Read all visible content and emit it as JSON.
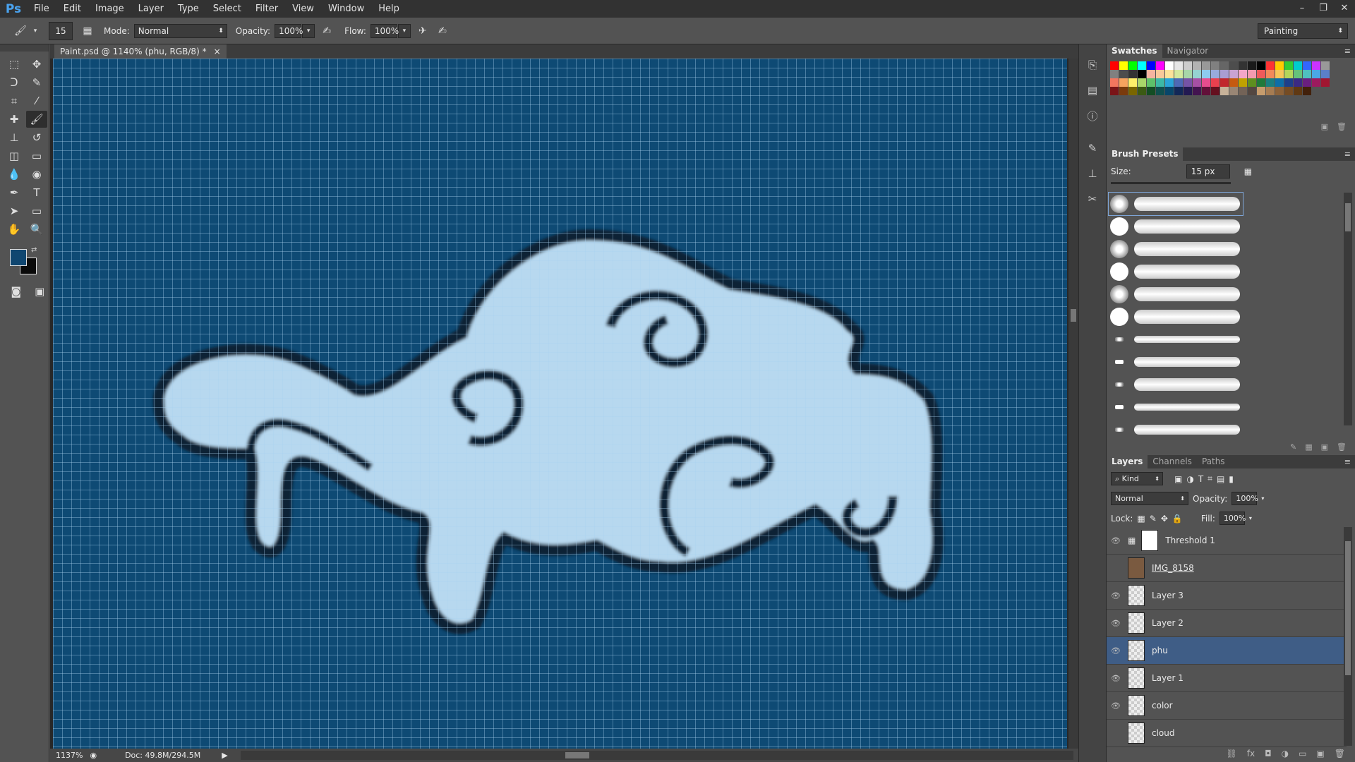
{
  "app": {
    "logo": "Ps"
  },
  "menu": [
    "File",
    "Edit",
    "Image",
    "Layer",
    "Type",
    "Select",
    "Filter",
    "View",
    "Window",
    "Help"
  ],
  "window_controls": [
    "–",
    "❐",
    "✕"
  ],
  "options": {
    "brush_size": "15",
    "mode_label": "Mode:",
    "mode_value": "Normal",
    "opacity_label": "Opacity:",
    "opacity_value": "100%",
    "flow_label": "Flow:",
    "flow_value": "100%",
    "workspace": "Painting"
  },
  "tools": [
    {
      "name": "marquee-icon",
      "glyph": "⬚"
    },
    {
      "name": "move-icon",
      "glyph": "✥"
    },
    {
      "name": "lasso-icon",
      "glyph": "ᑐ"
    },
    {
      "name": "quick-select-icon",
      "glyph": "✎"
    },
    {
      "name": "crop-icon",
      "glyph": "⌗"
    },
    {
      "name": "eyedropper-icon",
      "glyph": "⁄"
    },
    {
      "name": "healing-icon",
      "glyph": "✚"
    },
    {
      "name": "brush-icon",
      "glyph": "🖌"
    },
    {
      "name": "stamp-icon",
      "glyph": "⊥"
    },
    {
      "name": "history-brush-icon",
      "glyph": "↺"
    },
    {
      "name": "eraser-icon",
      "glyph": "◫"
    },
    {
      "name": "gradient-icon",
      "glyph": "▭"
    },
    {
      "name": "blur-icon",
      "glyph": "💧"
    },
    {
      "name": "dodge-icon",
      "glyph": "◉"
    },
    {
      "name": "pen-icon",
      "glyph": "✒"
    },
    {
      "name": "type-icon",
      "glyph": "T"
    },
    {
      "name": "path-select-icon",
      "glyph": "➤"
    },
    {
      "name": "shape-icon",
      "glyph": "▭"
    },
    {
      "name": "hand-icon",
      "glyph": "✋"
    },
    {
      "name": "zoom-icon",
      "glyph": "🔍"
    }
  ],
  "colors": {
    "foreground": "#0f4670",
    "background": "#0a0a0a"
  },
  "document": {
    "tab_title": "Paint.psd @ 1140% (phu, RGB/8) *",
    "close": "×"
  },
  "status": {
    "zoom": "1137%",
    "doc": "Doc: 49.8M/294.5M"
  },
  "swatches_panel": {
    "tabs": [
      "Swatches",
      "Navigator"
    ]
  },
  "swatch_colors": [
    "#ff0000",
    "#ffff00",
    "#00ff00",
    "#00ffff",
    "#0000ff",
    "#ff00ff",
    "#ffffff",
    "#e6e6e6",
    "#cccccc",
    "#b3b3b3",
    "#999999",
    "#808080",
    "#666666",
    "#4d4d4d",
    "#333333",
    "#1a1a1a",
    "#000000",
    "#ff3333",
    "#ffcc00",
    "#33cc33",
    "#00cccc",
    "#3366ff",
    "#cc33ff",
    "#999999",
    "#808080",
    "#4d4d4d",
    "#333333",
    "#000000",
    "#f5b4a0",
    "#f9c89a",
    "#fde39a",
    "#d4e99e",
    "#a7d6a8",
    "#95d3d1",
    "#8ecbf0",
    "#98abdb",
    "#a99dd2",
    "#c9a3d3",
    "#f3a6c8",
    "#f39ab0",
    "#ef5a5a",
    "#f28a5a",
    "#f7c65a",
    "#b5d65a",
    "#66c27a",
    "#4fc0c0",
    "#4aa8e6",
    "#5b7fc9",
    "#f3765f",
    "#f7a45f",
    "#fff06a",
    "#a9d66a",
    "#5ec16a",
    "#3cb8a6",
    "#2aa3d8",
    "#4d69b5",
    "#7653a6",
    "#a650a4",
    "#e64d8e",
    "#e8404e",
    "#c1272d",
    "#c55a11",
    "#bfa100",
    "#5e8f1f",
    "#1f7a3a",
    "#1a7f7f",
    "#0d6ea8",
    "#1d3f8a",
    "#3b2a84",
    "#6a1f7f",
    "#9c1a5e",
    "#a01631",
    "#7a1417",
    "#7a3a0c",
    "#7a6600",
    "#3b5a13",
    "#134d24",
    "#104f4f",
    "#08466a",
    "#122857",
    "#231a52",
    "#431450",
    "#621039",
    "#65101f",
    "#c7b299",
    "#998675",
    "#736357",
    "#534741",
    "#c69c6d",
    "#a67c52",
    "#8c6239",
    "#754c24",
    "#603913",
    "#42210b",
    "#535353",
    "#535353"
  ],
  "brush_panel": {
    "title": "Brush Presets",
    "size_label": "Size:",
    "size_value": "15 px"
  },
  "layers_panel": {
    "tabs": [
      "Layers",
      "Channels",
      "Paths"
    ],
    "filter": "Kind",
    "blend": "Normal",
    "opacity_label": "Opacity:",
    "opacity_value": "100%",
    "lock_label": "Lock:",
    "fill_label": "Fill:",
    "fill_value": "100%"
  },
  "layers": [
    {
      "name": "Threshold 1",
      "visible": true,
      "thumb": "white",
      "selected": false,
      "underline": false
    },
    {
      "name": "IMG_8158",
      "visible": false,
      "thumb": "photo",
      "selected": false,
      "underline": true
    },
    {
      "name": "Layer 3",
      "visible": true,
      "thumb": "checker",
      "selected": false,
      "underline": false
    },
    {
      "name": "Layer 2",
      "visible": true,
      "thumb": "checker",
      "selected": false,
      "underline": false
    },
    {
      "name": "phu",
      "visible": true,
      "thumb": "checker",
      "selected": true,
      "underline": false
    },
    {
      "name": "Layer 1",
      "visible": true,
      "thumb": "checker",
      "selected": false,
      "underline": false
    },
    {
      "name": "color",
      "visible": true,
      "thumb": "checker",
      "selected": false,
      "underline": false
    },
    {
      "name": "cloud",
      "visible": false,
      "thumb": "checker",
      "selected": false,
      "underline": false
    }
  ]
}
